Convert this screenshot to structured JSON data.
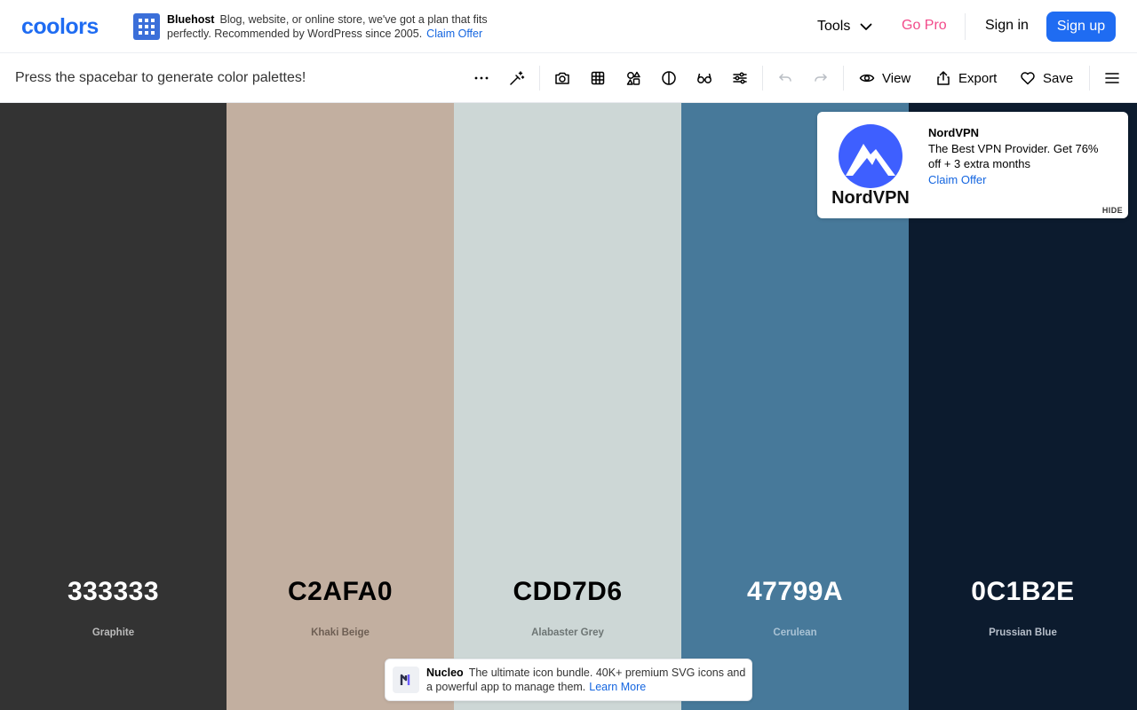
{
  "nav": {
    "logo_text": "coolors",
    "tools_label": "Tools",
    "gopro_label": "Go Pro",
    "signin_label": "Sign in",
    "signup_label": "Sign up",
    "colors": {
      "brand": "#1f6cf2",
      "gopro": "#f24a8a"
    }
  },
  "top_ad": {
    "brand": "Bluehost",
    "text": "Blog, website, or online store, we've got a plan that fits perfectly. Recommended by WordPress since 2005.",
    "cta": "Claim Offer",
    "icon": "grid-icon"
  },
  "toolbar": {
    "hint": "Press the spacebar to generate color palettes!",
    "icons": [
      "more-icon",
      "magic-wand-icon",
      "camera-icon",
      "grid-icon",
      "shapes-icon",
      "contrast-icon",
      "glasses-icon",
      "sliders-icon",
      "undo-icon",
      "redo-icon",
      "eye-icon",
      "export-icon",
      "heart-icon",
      "menu-icon"
    ],
    "view_label": "View",
    "export_label": "Export",
    "save_label": "Save"
  },
  "palette": [
    {
      "hex": "333333",
      "name": "Graphite",
      "color": "#333333",
      "text_color": "#ffffff",
      "name_color": "#bbbbbb"
    },
    {
      "hex": "C2AFA0",
      "name": "Khaki Beige",
      "color": "#C2AFA0",
      "text_color": "#000000",
      "name_color": "#6e5f54"
    },
    {
      "hex": "CDD7D6",
      "name": "Alabaster Grey",
      "color": "#CDD7D6",
      "text_color": "#000000",
      "name_color": "#6d7574"
    },
    {
      "hex": "47799A",
      "name": "Cerulean",
      "color": "#47799A",
      "text_color": "#ffffff",
      "name_color": "#a9c2d4"
    },
    {
      "hex": "0C1B2E",
      "name": "Prussian Blue",
      "color": "#0C1B2E",
      "text_color": "#ffffff",
      "name_color": "#b7bfca"
    }
  ],
  "nord_ad": {
    "brand": "NordVPN",
    "text": "The Best VPN Provider. Get 76% off + 3 extra months",
    "cta": "Claim Offer",
    "hide_label": "HIDE",
    "logo_word": "NordVPN",
    "color": "#3e5fff"
  },
  "nucleo_ad": {
    "brand": "Nucleo",
    "text": "The ultimate icon bundle. 40K+ premium SVG icons and a powerful app to manage them.",
    "cta": "Learn More"
  }
}
